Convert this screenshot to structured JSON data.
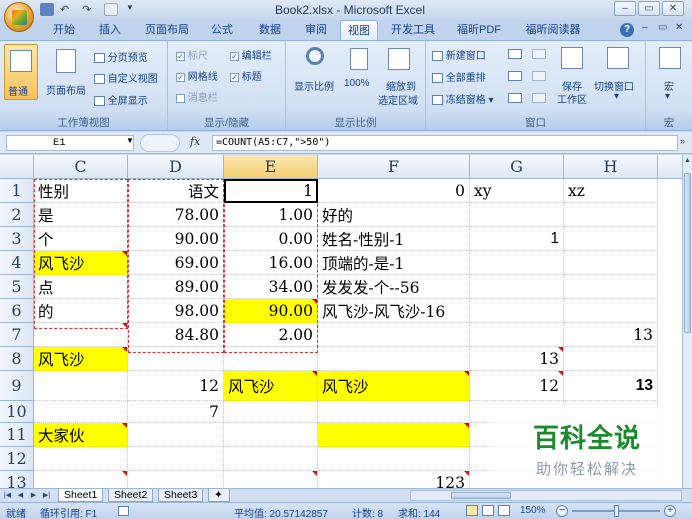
{
  "window": {
    "title": "Book2.xlsx - Microsoft Excel"
  },
  "tabs": [
    "开始",
    "插入",
    "页面布局",
    "公式",
    "数据",
    "审阅",
    "视图",
    "开发工具",
    "福昕PDF",
    "福昕阅读器"
  ],
  "active_tab": "视图",
  "ribbon": {
    "workbook_views": {
      "label": "工作簿视图",
      "normal": "普通",
      "page_layout": "页面布局",
      "page_break_preview": "分页预览",
      "custom_views": "自定义视图",
      "full_screen": "全屏显示"
    },
    "show_hide": {
      "label": "显示/隐藏",
      "ruler": "标尺",
      "formula_bar": "编辑栏",
      "gridlines": "网格线",
      "headings": "标题",
      "message_bar": "消息栏"
    },
    "zoom": {
      "label": "显示比例",
      "zoom": "显示比例",
      "hundred": "100%",
      "zoom_selection": "缩放到",
      "zoom_selection2": "选定区域"
    },
    "window": {
      "label": "窗口",
      "new_window": "新建窗口",
      "arrange_all": "全部重排",
      "freeze_panes": "冻结窗格",
      "save_workspace": "保存",
      "save_workspace2": "工作区",
      "switch_windows": "切换窗口"
    },
    "macros": {
      "label": "宏",
      "macro": "宏"
    }
  },
  "formula_bar": {
    "name_box": "E1",
    "fx": "fx",
    "formula": "=COUNT(A5:C7,\">50\")"
  },
  "columns": [
    "C",
    "D",
    "E",
    "F",
    "G",
    "H"
  ],
  "rows": [
    "1",
    "2",
    "3",
    "4",
    "5",
    "6",
    "7",
    "8",
    "9",
    "10",
    "11",
    "12",
    "13"
  ],
  "cells": {
    "C1": "性别",
    "D1": "语文",
    "E1": "1",
    "F1": "0",
    "G1": "xy",
    "H1": "xz",
    "C2": "是",
    "D2": "78.00",
    "E2": "1.00",
    "F2": "好的",
    "C3": "个",
    "D3": "90.00",
    "E3": "0.00",
    "F3": "姓名-性别-1",
    "G3": "1",
    "C4": "风飞沙",
    "D4": "69.00",
    "E4": "16.00",
    "F4": "顶端的-是-1",
    "C5": "点",
    "D5": "89.00",
    "E5": "34.00",
    "F5": "发发发-个--56",
    "C6": "的",
    "D6": "98.00",
    "E6": "90.00",
    "F6": "风飞沙-风飞沙-16",
    "D7": "84.80",
    "E7": "2.00",
    "H7": "13",
    "C8": "风飞沙",
    "G8": "13",
    "D9": "12",
    "E9": "风飞沙",
    "F9": "风飞沙",
    "G9": "12",
    "H9": "13",
    "D10": "7",
    "C11": "大家伙",
    "F13": "123"
  },
  "sheets": [
    "Sheet1",
    "Sheet2",
    "Sheet3"
  ],
  "active_sheet": "Sheet1",
  "status": {
    "ready": "就绪",
    "circular": "循环引用: F1",
    "average": "平均值: 20.57142857",
    "count": "计数: 8",
    "sum": "求和: 144",
    "zoom": "150%"
  },
  "watermark": {
    "title": "百科全说",
    "subtitle": "助你轻松解决"
  },
  "colors": {
    "highlight": "#ffff00",
    "ribbon_bg": "#d5e3f4",
    "watermark_green": "#1c8a2c"
  }
}
